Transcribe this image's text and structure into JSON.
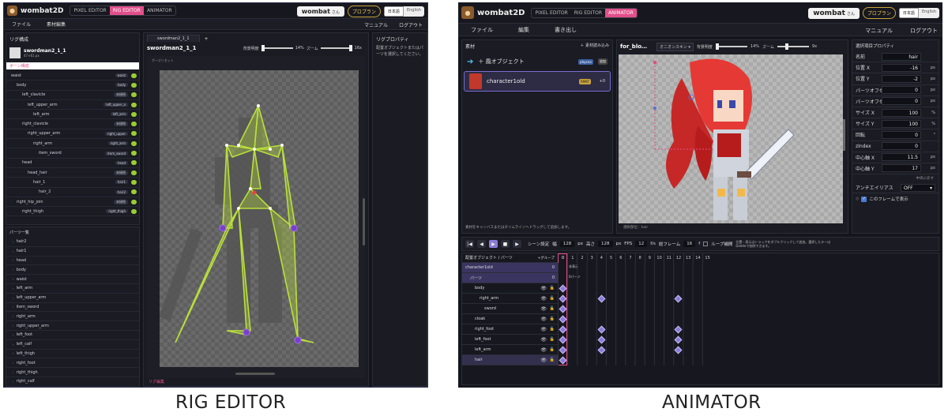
{
  "captions": {
    "left": "RIG EDITOR",
    "right": "ANIMATOR"
  },
  "app": {
    "name": "wombat2D",
    "user": "wombat",
    "honorific": "さん",
    "plan": "プロプラン",
    "lang_ja": "日本語",
    "lang_en": "English"
  },
  "modes": [
    "PIXEL EDITOR",
    "RIG EDITOR",
    "ANIMATOR"
  ],
  "rig": {
    "menu": [
      "ファイル",
      "素材編集"
    ],
    "menu_right": [
      "マニュアル",
      "ログアウト"
    ],
    "rig_header": "リグ構成",
    "asset_name": "swordman2_1_1",
    "asset_sub": "47×61 px",
    "bone_tab": "ボーン構成",
    "bones": [
      {
        "name": "waist",
        "indent": 0,
        "tag": "waist"
      },
      {
        "name": "body",
        "indent": 1,
        "tag": "body"
      },
      {
        "name": "left_clavicle",
        "indent": 2,
        "tag": "未接続"
      },
      {
        "name": "left_upper_arm",
        "indent": 3,
        "tag": "left_upper_a"
      },
      {
        "name": "left_arm",
        "indent": 4,
        "tag": "left_arm"
      },
      {
        "name": "right_clavicle",
        "indent": 2,
        "tag": "未接続"
      },
      {
        "name": "right_upper_arm",
        "indent": 3,
        "tag": "right_upper"
      },
      {
        "name": "right_arm",
        "indent": 4,
        "tag": "right_arm"
      },
      {
        "name": "item_sword",
        "indent": 5,
        "tag": "item_sword"
      },
      {
        "name": "head",
        "indent": 2,
        "tag": "head"
      },
      {
        "name": "head_hair",
        "indent": 3,
        "tag": "未接続"
      },
      {
        "name": "hair_1",
        "indent": 4,
        "tag": "hair1"
      },
      {
        "name": "hair_2",
        "indent": 5,
        "tag": "hair2"
      },
      {
        "name": "right_hip_join",
        "indent": 1,
        "tag": "未接続"
      },
      {
        "name": "right_thigh",
        "indent": 2,
        "tag": "right_thigh"
      }
    ],
    "parts_header": "パーツ一覧",
    "parts": [
      "hair2",
      "hair1",
      "head",
      "body",
      "waist",
      "left_arm",
      "left_upper_arm",
      "item_sword",
      "right_arm",
      "right_upper_arm",
      "left_foot",
      "left_calf",
      "left_thigh",
      "right_foot",
      "right_thigh",
      "right_calf"
    ],
    "tab_name": "swordman2_1_1",
    "canvas_title": "swordman2_1_1",
    "bg_label": "背景明度",
    "bg_value": "14%",
    "zoom_label": "ズーム",
    "zoom_value": "16x",
    "pose_reset": "ポーズリセット",
    "rig_reset": "リグ編集",
    "props_header": "リグプロパティ",
    "props_text": "配置オブジェクトまたはパーツを選択してください。"
  },
  "anim": {
    "menu": [
      "ファイル",
      "編集",
      "書き出し"
    ],
    "menu_right": [
      "マニュアル",
      "ログアウト"
    ],
    "assets_header": "素材",
    "load_btn": "＋ 素材読み込み",
    "asset1": "＋ 風オブジェクト",
    "asset1_tag": "physics",
    "asset1_tag2": "追加",
    "asset2": "character1old",
    "asset2_tag": "RMKT",
    "asset2_tag2": "+0",
    "drag_hint": "素材をキャンバスまたはタイムラインへドラッグして追加します。",
    "canvas_title": "for_blo…",
    "skin_select": "オニオンスキン",
    "bg_label": "背景明度",
    "bg_value": "14%",
    "zoom_label": "ズーム",
    "zoom_value": "9x",
    "status": "選択部位：hair",
    "props_header": "選択項目プロパティ",
    "props": [
      {
        "label": "名前",
        "value": "hair",
        "unit": ""
      },
      {
        "label": "位置 X",
        "value": "-16",
        "unit": "px"
      },
      {
        "label": "位置 Y",
        "value": "-2",
        "unit": "px"
      },
      {
        "label": "パーツオフセット X",
        "value": "0",
        "unit": "px"
      },
      {
        "label": "パーツオフセット Y",
        "value": "0",
        "unit": "px"
      },
      {
        "label": "サイズ X",
        "value": "100",
        "unit": "%"
      },
      {
        "label": "サイズ Y",
        "value": "100",
        "unit": "%"
      },
      {
        "label": "回転",
        "value": "0",
        "unit": "°"
      },
      {
        "label": "zIndex",
        "value": "0",
        "unit": ""
      },
      {
        "label": "中心軸 X",
        "value": "11.5",
        "unit": "px"
      },
      {
        "label": "中心軸 Y",
        "value": "17",
        "unit": "px"
      }
    ],
    "center_reset": "中央に戻す",
    "aa_label": "アンチエイリアス",
    "aa_value": "OFF",
    "show_frame": "このフレームで表示",
    "transport": {
      "scene": "シーン設定",
      "w_label": "幅",
      "w": "128",
      "w_unit": "px",
      "h_label": "高さ",
      "h": "128",
      "h_unit": "px",
      "fps_label": "FPS",
      "fps": "12",
      "fps_unit": "f/s",
      "total_label": "総フレーム",
      "total": "16",
      "total_unit": "f",
      "loop": "ループ補間",
      "hint": "位置・表示はトラックをダブルクリックして追加。選択したキーはDeleteで削除できます。"
    },
    "tl_header": "配置オブジェクト / パーツ",
    "tl_group": "+グループ",
    "frames": [
      "0",
      "1",
      "2",
      "3",
      "4",
      "5",
      "6",
      "7",
      "8",
      "9",
      "10",
      "11",
      "12",
      "13",
      "14",
      "15"
    ],
    "tracks": [
      {
        "name": "character1old",
        "indent": 0,
        "num": "0",
        "note": "非表示"
      },
      {
        "name": "パーツ",
        "indent": 1,
        "num": "0",
        "note": "0パーツ"
      },
      {
        "name": "body",
        "indent": 2,
        "num": "",
        "note": ""
      },
      {
        "name": "right_arm",
        "indent": 3,
        "num": "",
        "note": ""
      },
      {
        "name": "sword",
        "indent": 4,
        "num": "",
        "note": ""
      },
      {
        "name": "cloak",
        "indent": 2,
        "num": "",
        "note": ""
      },
      {
        "name": "right_foot",
        "indent": 2,
        "num": "",
        "note": ""
      },
      {
        "name": "left_foot",
        "indent": 2,
        "num": "",
        "note": ""
      },
      {
        "name": "left_arm",
        "indent": 2,
        "num": "",
        "note": ""
      },
      {
        "name": "hair",
        "indent": 2,
        "num": "",
        "note": ""
      }
    ]
  }
}
